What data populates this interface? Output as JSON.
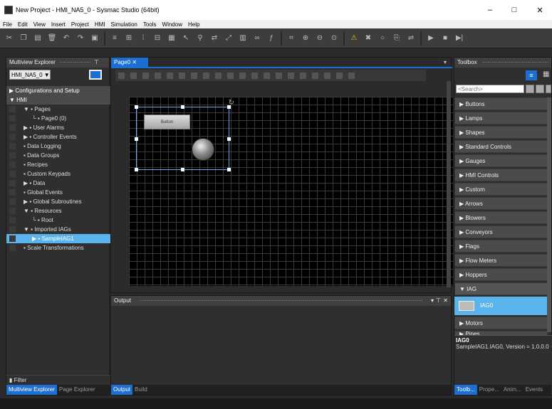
{
  "window": {
    "title": "New Project - HMI_NA5_0 - Sysmac Studio (64bit)",
    "minimize": "–",
    "maximize": "□",
    "close": "✕"
  },
  "menu": [
    "File",
    "Edit",
    "View",
    "Insert",
    "Project",
    "HMI",
    "Simulation",
    "Tools",
    "Window",
    "Help"
  ],
  "toolbar_icons": [
    "cut-icon",
    "copy-icon",
    "paste-icon",
    "delete-icon",
    "undo-icon",
    "redo-icon",
    "build-icon",
    "align-icon",
    "group-icon",
    "distribute-icon",
    "size-icon",
    "grid-icon",
    "cursor-icon",
    "find-icon",
    "replace-icon",
    "cross-ref-icon",
    "library-icon",
    "link-icon",
    "variable-icon",
    "zoom-fit-icon",
    "zoom-in-icon",
    "zoom-out-icon",
    "zoom-reset-icon",
    "warning-icon",
    "stop-warning-icon",
    "sync-icon",
    "online-icon",
    "transfer-icon",
    "run-icon",
    "stop-icon",
    "step-icon"
  ],
  "left_panel": {
    "title": "Multiview Explorer",
    "device": "HMI_NA5_0",
    "tree": [
      {
        "label": "Configurations and Setup",
        "level": 0,
        "arrow": "▶"
      },
      {
        "label": "HMI",
        "level": 0,
        "arrow": "▼"
      },
      {
        "label": "Pages",
        "level": 1,
        "arrow": "▼"
      },
      {
        "label": "Page0 (0)",
        "level": 2,
        "arrow": "└"
      },
      {
        "label": "User Alarms",
        "level": 1,
        "arrow": "▶"
      },
      {
        "label": "Controller Events",
        "level": 1,
        "arrow": "▶"
      },
      {
        "label": "Data Logging",
        "level": 1,
        "arrow": ""
      },
      {
        "label": "Data Groups",
        "level": 1,
        "arrow": ""
      },
      {
        "label": "Recipes",
        "level": 1,
        "arrow": ""
      },
      {
        "label": "Custom Keypads",
        "level": 1,
        "arrow": ""
      },
      {
        "label": "Data",
        "level": 1,
        "arrow": "▶"
      },
      {
        "label": "Global Events",
        "level": 1,
        "arrow": ""
      },
      {
        "label": "Global Subroutines",
        "level": 1,
        "arrow": "▶"
      },
      {
        "label": "Resources",
        "level": 1,
        "arrow": "▼"
      },
      {
        "label": "Root",
        "level": 2,
        "arrow": "└"
      },
      {
        "label": "Imported IAGs",
        "level": 1,
        "arrow": "▼"
      },
      {
        "label": "SampleIAG1",
        "level": 2,
        "arrow": "▶",
        "selected": true
      },
      {
        "label": "Scale Transformations",
        "level": 1,
        "arrow": ""
      }
    ],
    "filter_label": "Filter",
    "tabs": [
      "Multiview Explorer",
      "Page Explorer"
    ]
  },
  "editor": {
    "tab": "Page0",
    "button_label": "Button"
  },
  "output": {
    "title": "Output",
    "tabs": [
      "Output",
      "Build"
    ]
  },
  "toolbox": {
    "title": "Toolbox",
    "search_placeholder": "<Search>",
    "categories_before": [
      "Buttons",
      "Lamps",
      "Shapes",
      "Standard Controls",
      "Gauges",
      "HMI Controls",
      "Custom",
      "Arrows",
      "Blowers",
      "Conveyors",
      "Flags",
      "Flow Meters",
      "Hoppers"
    ],
    "open_category": "IAG",
    "open_item": "IAG0",
    "categories_after": [
      "Motors",
      "Pipes"
    ],
    "info_name": "IAG0",
    "info_desc": "SampleIAG1.IAG0, Version = 1.0.0.0",
    "tabs": [
      "Toolb...",
      "Prope...",
      "Anim...",
      "Events"
    ]
  },
  "colors": {
    "accent": "#1c6fd1",
    "selection": "#5ab3ea",
    "background": "#2b2b2b"
  }
}
